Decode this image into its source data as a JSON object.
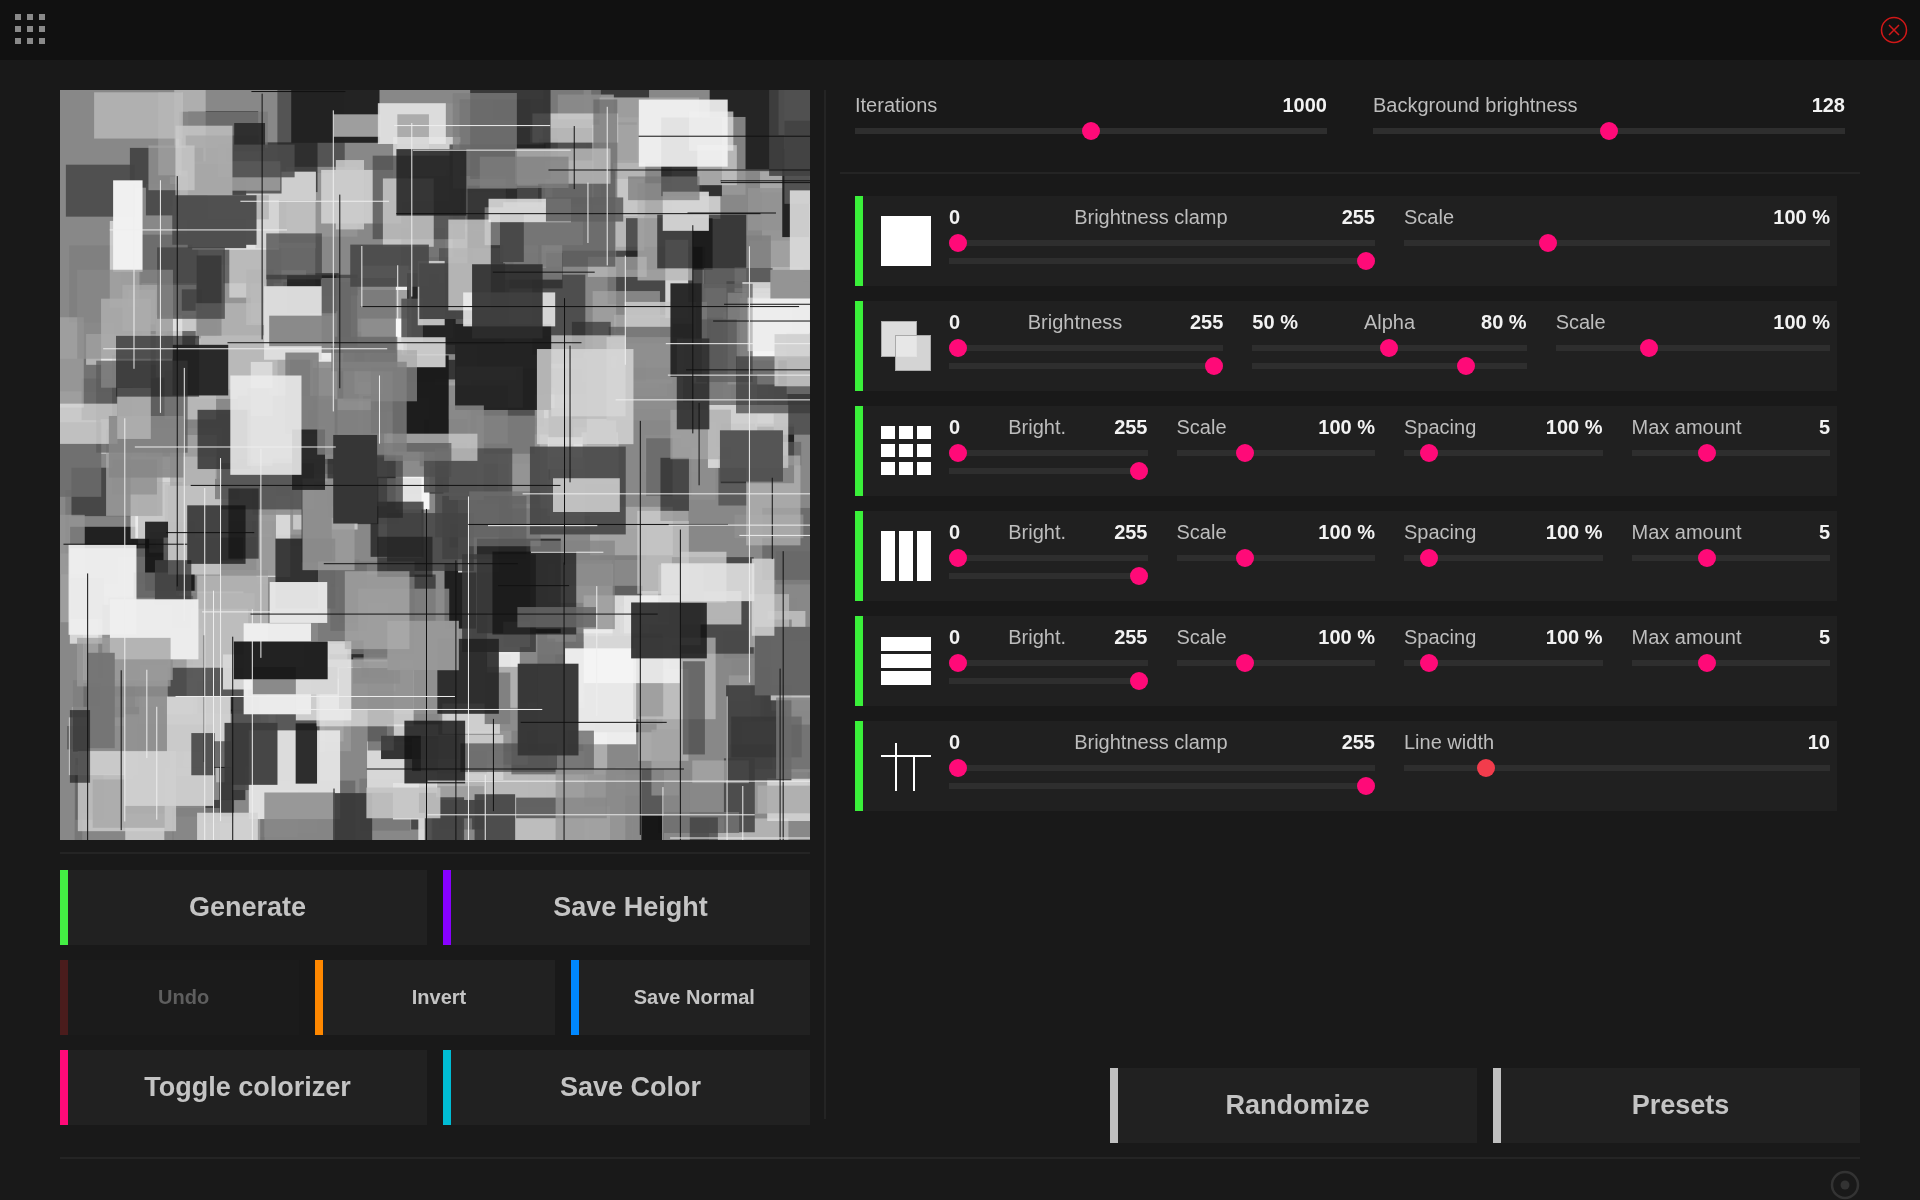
{
  "left_buttons": [
    [
      {
        "label": "Generate",
        "color": "#44ee44",
        "disabled": false
      },
      {
        "label": "Save Height",
        "color": "#8800ff",
        "disabled": false
      }
    ],
    [
      {
        "label": "Undo",
        "color": "#4a1c1c",
        "disabled": true
      },
      {
        "label": "Invert",
        "color": "#ff8800",
        "disabled": false
      },
      {
        "label": "Save Normal",
        "color": "#0088ff",
        "disabled": false
      }
    ],
    [
      {
        "label": "Toggle colorizer",
        "color": "#ff0a78",
        "disabled": false
      },
      {
        "label": "Save Color",
        "color": "#00bcd4",
        "disabled": false
      }
    ]
  ],
  "top_sliders": [
    {
      "label": "Iterations",
      "value": "1000",
      "level": 0.5
    },
    {
      "label": "Background brightness",
      "value": "128",
      "level": 0.5
    }
  ],
  "layers": [
    {
      "kind": "square",
      "enabled": true,
      "controls": [
        {
          "kind": "range",
          "min": "0",
          "label": "Brightness clamp",
          "max": "255",
          "thumbs": [
            {
              "level": 0
            },
            {
              "level": 1
            }
          ]
        },
        {
          "kind": "slider",
          "label": "Scale",
          "value": "100 %",
          "level": 0.33,
          "hovered": false
        }
      ]
    },
    {
      "kind": "overlap",
      "enabled": true,
      "controls": [
        {
          "kind": "range",
          "min": "0",
          "label": "Brightness",
          "max": "255",
          "thumbs": [
            {
              "level": 0
            },
            {
              "level": 1
            }
          ]
        },
        {
          "kind": "range",
          "min": "50 %",
          "label": "Alpha",
          "max": "80 %",
          "thumbs": [
            {
              "level": 0.5
            },
            {
              "level": 0.8
            }
          ]
        },
        {
          "kind": "slider",
          "label": "Scale",
          "value": "100 %",
          "level": 0.33,
          "hovered": false
        }
      ]
    },
    {
      "kind": "grid",
      "enabled": true,
      "controls": [
        {
          "kind": "range",
          "min": "0",
          "label": "Bright.",
          "max": "255",
          "thumbs": [
            {
              "level": 0
            },
            {
              "level": 1
            }
          ]
        },
        {
          "kind": "slider",
          "label": "Scale",
          "value": "100 %",
          "level": 0.33,
          "hovered": false
        },
        {
          "kind": "slider",
          "label": "Spacing",
          "value": "100 %",
          "level": 0.09,
          "hovered": false
        },
        {
          "kind": "slider",
          "label": "Max amount",
          "value": "5",
          "level": 0.37,
          "hovered": false
        }
      ]
    },
    {
      "kind": "columns",
      "enabled": true,
      "controls": [
        {
          "kind": "range",
          "min": "0",
          "label": "Bright.",
          "max": "255",
          "thumbs": [
            {
              "level": 0
            },
            {
              "level": 1
            }
          ]
        },
        {
          "kind": "slider",
          "label": "Scale",
          "value": "100 %",
          "level": 0.33,
          "hovered": false
        },
        {
          "kind": "slider",
          "label": "Spacing",
          "value": "100 %",
          "level": 0.09,
          "hovered": false
        },
        {
          "kind": "slider",
          "label": "Max amount",
          "value": "5",
          "level": 0.37,
          "hovered": false
        }
      ]
    },
    {
      "kind": "rows",
      "enabled": true,
      "controls": [
        {
          "kind": "range",
          "min": "0",
          "label": "Bright.",
          "max": "255",
          "thumbs": [
            {
              "level": 0
            },
            {
              "level": 1
            }
          ]
        },
        {
          "kind": "slider",
          "label": "Scale",
          "value": "100 %",
          "level": 0.33,
          "hovered": false
        },
        {
          "kind": "slider",
          "label": "Spacing",
          "value": "100 %",
          "level": 0.09,
          "hovered": false
        },
        {
          "kind": "slider",
          "label": "Max amount",
          "value": "5",
          "level": 0.37,
          "hovered": false
        }
      ]
    },
    {
      "kind": "lines",
      "enabled": true,
      "controls": [
        {
          "kind": "range",
          "min": "0",
          "label": "Brightness clamp",
          "max": "255",
          "thumbs": [
            {
              "level": 0
            },
            {
              "level": 1
            }
          ]
        },
        {
          "kind": "slider",
          "label": "Line width",
          "value": "10",
          "level": 0.18,
          "hovered": true
        }
      ]
    }
  ],
  "right_buttons": [
    {
      "label": "Randomize",
      "color": "#c0c0c0"
    },
    {
      "label": "Presets",
      "color": "#c0c0c0"
    }
  ]
}
